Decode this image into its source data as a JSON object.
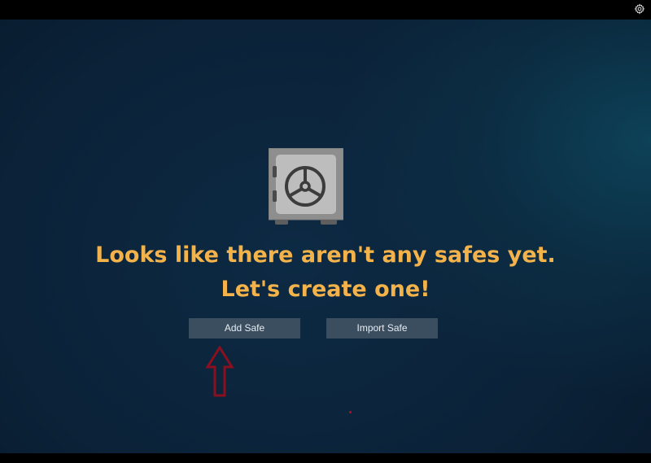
{
  "empty_state": {
    "message_line1": "Looks like there aren't any safes yet.",
    "message_line2": "Let's create one!",
    "icon": "safe-icon"
  },
  "actions": {
    "add_label": "Add Safe",
    "import_label": "Import Safe"
  },
  "toolbar": {
    "settings_icon": "gear-icon"
  },
  "colors": {
    "headline": "#f4b34a",
    "button_bg": "#3b4e60",
    "button_text": "#e6ecf1",
    "annotation": "#8a0f1f",
    "background_dark": "#0b2238",
    "background_teal": "#0e485e"
  }
}
